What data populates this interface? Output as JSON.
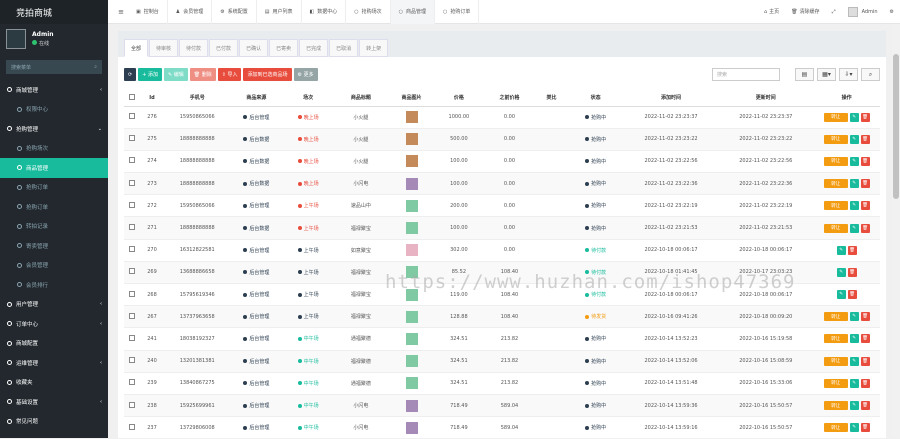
{
  "brand": "竞拍商城",
  "user": {
    "name": "Admin",
    "status": "在线"
  },
  "search_placeholder": "搜索菜单",
  "menu": [
    {
      "label": "商城管理",
      "type": "header",
      "arrow": "‹"
    },
    {
      "label": "权限中心",
      "type": "sub"
    },
    {
      "label": "抢购管理",
      "type": "header",
      "arrow": "⌄"
    },
    {
      "label": "抢购场次",
      "type": "sub"
    },
    {
      "label": "商品管理",
      "type": "sub",
      "active": true
    },
    {
      "label": "抢购订单",
      "type": "sub"
    },
    {
      "label": "抢购订单",
      "type": "sub"
    },
    {
      "label": "转拍记录",
      "type": "sub"
    },
    {
      "label": "寄卖管理",
      "type": "sub"
    },
    {
      "label": "会员管理",
      "type": "sub"
    },
    {
      "label": "会员排行",
      "type": "sub"
    },
    {
      "label": "用户管理",
      "type": "header",
      "arrow": "‹"
    },
    {
      "label": "订单中心",
      "type": "header",
      "arrow": "‹"
    },
    {
      "label": "商城配置",
      "type": "header"
    },
    {
      "label": "运维管理",
      "type": "header",
      "arrow": "‹"
    },
    {
      "label": "收藏夹",
      "type": "header"
    },
    {
      "label": "基础设置",
      "type": "header",
      "arrow": "‹"
    },
    {
      "label": "常见问题",
      "type": "header"
    }
  ],
  "topbar": {
    "tabs": [
      {
        "icon": "▣",
        "label": "控制台"
      },
      {
        "icon": "♟",
        "label": "会员管理"
      },
      {
        "icon": "⚙",
        "label": "系统配置"
      },
      {
        "icon": "▤",
        "label": "用户列表"
      },
      {
        "icon": "◧",
        "label": "数据中心"
      },
      {
        "icon": "○",
        "label": "抢购场次"
      },
      {
        "icon": "○",
        "label": "商品管理",
        "active": true
      },
      {
        "icon": "○",
        "label": "抢购订单"
      }
    ],
    "home": "主页",
    "clear_cache": "清除缓存",
    "admin": "Admin"
  },
  "subtabs": [
    "全部",
    "待审核",
    "待付款",
    "已付款",
    "已确认",
    "已寄卖",
    "已完成",
    "已取消",
    "转上架"
  ],
  "toolbar": {
    "add": "+ 添加",
    "edit": "✎ 编辑",
    "delete": "🗑 删除",
    "import": "⇪ 导入",
    "batch": "添加到已选商品场",
    "more": "⚙ 更多"
  },
  "search_input_placeholder": "搜索",
  "table": {
    "headers": [
      "Id",
      "手机号",
      "商品来源",
      "场次",
      "商品标题",
      "商品图片",
      "价格",
      "之前价格",
      "类比",
      "状态",
      "添加时间",
      "更新时间",
      "操作"
    ],
    "rows": [
      {
        "id": "276",
        "phone": "15950865066",
        "source": "后台管理",
        "session": "晚上场",
        "sess_color": "#e74c3c",
        "title": "小火腿",
        "img": "#c48a5a",
        "price": "1000.00",
        "prev": "0.00",
        "status": "抢购中",
        "status_color": "#2c3e50",
        "added": "2022-11-02 23:23:37",
        "updated": "2022-11-02 23:23:37",
        "warn": "转让"
      },
      {
        "id": "275",
        "phone": "18888888888",
        "source": "后台数据",
        "session": "晚上场",
        "sess_color": "#e74c3c",
        "title": "小火腿",
        "img": "#c48a5a",
        "price": "500.00",
        "prev": "0.00",
        "status": "抢购中",
        "status_color": "#2c3e50",
        "added": "2022-11-02 23:23:22",
        "updated": "2022-11-02 23:23:22",
        "warn": "转让"
      },
      {
        "id": "274",
        "phone": "18888888888",
        "source": "后台数据",
        "session": "晚上场",
        "sess_color": "#e74c3c",
        "title": "小火腿",
        "img": "#c48a5a",
        "price": "100.00",
        "prev": "0.00",
        "status": "抢购中",
        "status_color": "#2c3e50",
        "added": "2022-11-02 23:22:56",
        "updated": "2022-11-02 23:22:56",
        "warn": "转让"
      },
      {
        "id": "273",
        "phone": "18888888888",
        "source": "后台数据",
        "session": "晚上场",
        "sess_color": "#e74c3c",
        "title": "小闪电",
        "img": "#a58ab8",
        "price": "100.00",
        "prev": "0.00",
        "status": "抢购中",
        "status_color": "#2c3e50",
        "added": "2022-11-02 23:22:36",
        "updated": "2022-11-02 23:22:36",
        "warn": "转让"
      },
      {
        "id": "272",
        "phone": "15950865066",
        "source": "后台管理",
        "session": "上午场",
        "sess_color": "#e74c3c",
        "title": "速品山中",
        "img": "#7fc9a3",
        "price": "200.00",
        "prev": "0.00",
        "status": "抢购中",
        "status_color": "#2c3e50",
        "added": "2022-11-02 23:22:19",
        "updated": "2022-11-02 23:22:19",
        "warn": "转让"
      },
      {
        "id": "271",
        "phone": "18888888888",
        "source": "后台数据",
        "session": "上午场",
        "sess_color": "#e74c3c",
        "title": "福禄聚宝",
        "img": "#7fc9a3",
        "price": "100.00",
        "prev": "0.00",
        "status": "抢购中",
        "status_color": "#2c3e50",
        "added": "2022-11-02 23:21:53",
        "updated": "2022-11-02 23:21:53",
        "warn": "转让"
      },
      {
        "id": "270",
        "phone": "16312822581",
        "source": "后台管理",
        "session": "上午场",
        "sess_color": "#2c3e50",
        "title": "如意聚宝",
        "img": "#e8b4c4",
        "price": "302.00",
        "prev": "0.00",
        "status": "待付款",
        "status_color": "#18bc9c",
        "added": "2022-10-18 00:06:17",
        "updated": "2022-10-18 00:06:17",
        "warn": ""
      },
      {
        "id": "269",
        "phone": "13688886658",
        "source": "后台管理",
        "session": "上午场",
        "sess_color": "#2c3e50",
        "title": "福禄聚宝",
        "img": "#7fc9a3",
        "price": "85.52",
        "prev": "108.40",
        "status": "待付款",
        "status_color": "#18bc9c",
        "added": "2022-10-18 01:41:45",
        "updated": "2022-10-17 23:03:23",
        "warn": ""
      },
      {
        "id": "268",
        "phone": "15795619346",
        "source": "后台管理",
        "session": "上午场",
        "sess_color": "#2c3e50",
        "title": "福禄聚宝",
        "img": "#7fc9a3",
        "price": "119.00",
        "prev": "108.40",
        "status": "待付款",
        "status_color": "#18bc9c",
        "added": "2022-10-18 00:06:17",
        "updated": "2022-10-18 00:06:17",
        "warn": ""
      },
      {
        "id": "267",
        "phone": "13737963658",
        "source": "后台管理",
        "session": "上午场",
        "sess_color": "#2c3e50",
        "title": "福禄聚宝",
        "img": "#7fc9a3",
        "price": "128.88",
        "prev": "108.40",
        "status": "待发货",
        "status_color": "#f39c12",
        "added": "2022-10-16 09:41:26",
        "updated": "2022-10-18 00:09:20",
        "warn": "转让"
      },
      {
        "id": "241",
        "phone": "18038192327",
        "source": "后台管理",
        "session": "中午场",
        "sess_color": "#18bc9c",
        "title": "通福聚德",
        "img": "#7fc9a3",
        "price": "324.51",
        "prev": "213.82",
        "status": "抢购中",
        "status_color": "#2c3e50",
        "added": "2022-10-14 13:52:23",
        "updated": "2022-10-16 15:19:58",
        "warn": "转让"
      },
      {
        "id": "240",
        "phone": "13201381381",
        "source": "后台管理",
        "session": "中午场",
        "sess_color": "#18bc9c",
        "title": "福禄聚德",
        "img": "#7fc9a3",
        "price": "324.51",
        "prev": "213.82",
        "status": "抢购中",
        "status_color": "#2c3e50",
        "added": "2022-10-14 13:52:06",
        "updated": "2022-10-16 15:08:59",
        "warn": "转让"
      },
      {
        "id": "239",
        "phone": "13840867275",
        "source": "后台管理",
        "session": "中午场",
        "sess_color": "#18bc9c",
        "title": "通福聚德",
        "img": "#7fc9a3",
        "price": "324.51",
        "prev": "213.82",
        "status": "抢购中",
        "status_color": "#2c3e50",
        "added": "2022-10-14 13:51:48",
        "updated": "2022-10-16 15:33:06",
        "warn": "转让"
      },
      {
        "id": "238",
        "phone": "15925699961",
        "source": "后台管理",
        "session": "中午场",
        "sess_color": "#18bc9c",
        "title": "小闪电",
        "img": "#a58ab8",
        "price": "718.49",
        "prev": "589.04",
        "status": "抢购中",
        "status_color": "#2c3e50",
        "added": "2022-10-14 13:59:36",
        "updated": "2022-10-16 15:50:57",
        "warn": "转让"
      },
      {
        "id": "237",
        "phone": "13729806008",
        "source": "后台管理",
        "session": "中午场",
        "sess_color": "#18bc9c",
        "title": "小闪电",
        "img": "#a58ab8",
        "price": "718.49",
        "prev": "589.04",
        "status": "抢购中",
        "status_color": "#2c3e50",
        "added": "2022-10-14 13:59:16",
        "updated": "2022-10-16 15:50:57",
        "warn": "转让"
      }
    ]
  },
  "watermark": "https://www.huzhan.com/ishop47369"
}
